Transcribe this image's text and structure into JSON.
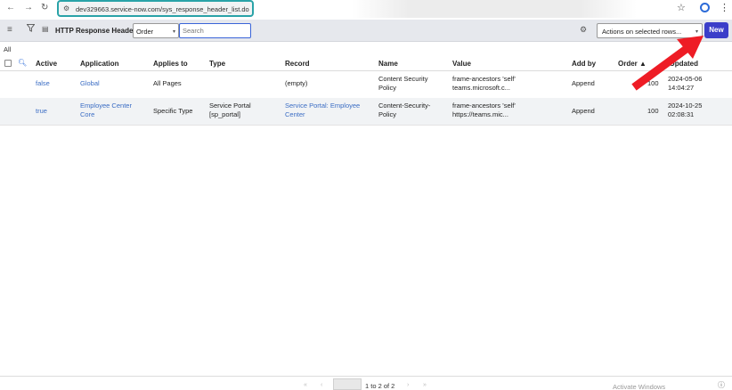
{
  "browser": {
    "url": "dev329663.service-now.com/sys_response_header_list.do"
  },
  "list": {
    "title": "HTTP Response Headers",
    "search_field": "Order",
    "search_placeholder": "Search",
    "actions_label": "Actions on selected rows...",
    "new_label": "New",
    "breadcrumb": "All"
  },
  "columns": [
    "Active",
    "Application",
    "Applies to",
    "Type",
    "Record",
    "Name",
    "Value",
    "Add by",
    "Order ▲",
    "Updated"
  ],
  "rows": [
    {
      "active": "false",
      "application": "Global",
      "applies_to": "All Pages",
      "type": "",
      "record": "(empty)",
      "name": "Content Security\nPolicy",
      "value": "frame-ancestors 'self'\nteams.microsoft.c...",
      "add_by": "Append",
      "order": "100",
      "updated": "2024-05-06\n14:04:27"
    },
    {
      "active": "true",
      "application": "Employee Center\nCore",
      "applies_to": "Specific Type",
      "type": "Service Portal\n[sp_portal]",
      "record": "Service Portal: Employee\nCenter",
      "name": "Content-Security-\nPolicy",
      "value": "frame-ancestors 'self'\nhttps://teams.mic...",
      "add_by": "Append",
      "order": "100",
      "updated": "2024-10-25\n02:08:31"
    }
  ],
  "pagination": {
    "page_range": "1  to 2 of 2"
  },
  "watermark": "Activate Windows",
  "colors": {
    "accent": "#3b3ec9",
    "link": "#3b6dc4",
    "url_border": "#2aa3a8",
    "annotation_arrow": "#ee1c25"
  }
}
